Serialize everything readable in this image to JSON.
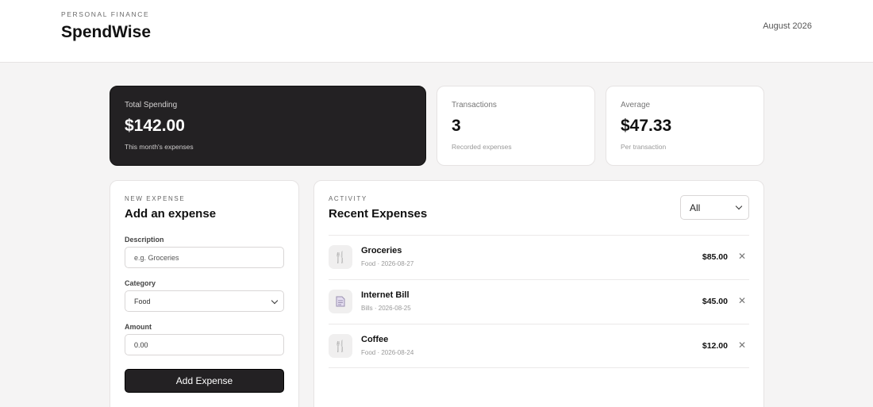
{
  "header": {
    "eyebrow": "PERSONAL FINANCE",
    "brand": "SpendWise",
    "month": "August 2026"
  },
  "stats": {
    "total": {
      "label": "Total Spending",
      "value": "$142.00",
      "sub": "This month's expenses"
    },
    "transactions": {
      "label": "Transactions",
      "value": "3",
      "sub": "Recorded expenses"
    },
    "average": {
      "label": "Average",
      "value": "$47.33",
      "sub": "Per transaction"
    }
  },
  "form": {
    "eyebrow": "NEW EXPENSE",
    "title": "Add an expense",
    "description_label": "Description",
    "description_placeholder": "e.g. Groceries",
    "category_label": "Category",
    "category_value": "Food",
    "amount_label": "Amount",
    "amount_value": "0.00",
    "submit_label": "Add Expense"
  },
  "activity": {
    "eyebrow": "ACTIVITY",
    "title": "Recent Expenses",
    "filter_value": "All",
    "items": [
      {
        "name": "Groceries",
        "meta": "Food · 2026-08-27",
        "amount": "$85.00",
        "icon": "utensils-icon"
      },
      {
        "name": "Internet Bill",
        "meta": "Bills · 2026-08-25",
        "amount": "$45.00",
        "icon": "receipt-icon"
      },
      {
        "name": "Coffee",
        "meta": "Food · 2026-08-24",
        "amount": "$12.00",
        "icon": "utensils-icon"
      }
    ]
  },
  "colors": {
    "accent_dark": "#232123",
    "background": "#f5f4f4",
    "icon_tint": "#8a8696"
  }
}
